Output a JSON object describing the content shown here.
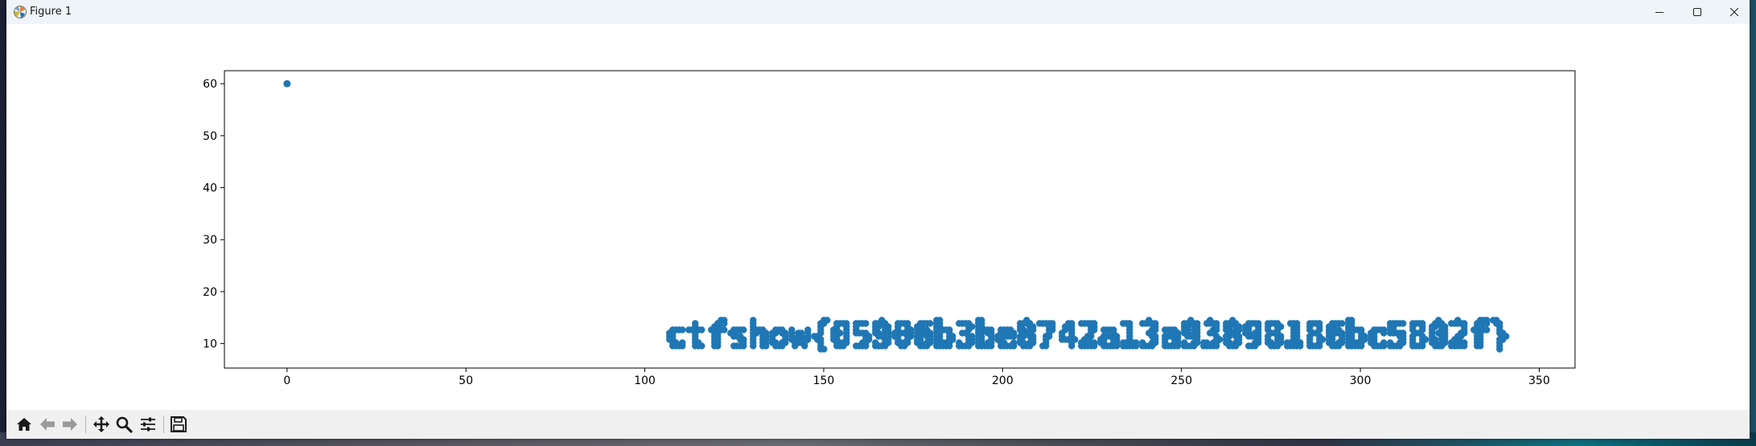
{
  "window": {
    "title": "Figure 1"
  },
  "toolbar": {
    "buttons": [
      {
        "name": "home-icon",
        "label": "Home"
      },
      {
        "name": "back-arrow-icon",
        "label": "Back"
      },
      {
        "name": "forward-arrow-icon",
        "label": "Forward"
      },
      {
        "name": "pan-icon",
        "label": "Pan"
      },
      {
        "name": "zoom-icon",
        "label": "Zoom"
      },
      {
        "name": "configure-subplots-icon",
        "label": "Subplots"
      },
      {
        "name": "save-icon",
        "label": "Save"
      }
    ]
  },
  "colors": {
    "marker": "#1f77b4",
    "titlebar": "#eff4f8",
    "toolbar": "#f0f0f0"
  },
  "chart_data": {
    "type": "scatter",
    "title": "",
    "xlabel": "",
    "ylabel": "",
    "xlim": [
      -17.5,
      360
    ],
    "ylim": [
      5.3,
      62.5
    ],
    "xticks": [
      0,
      50,
      100,
      150,
      200,
      250,
      300,
      350
    ],
    "yticks": [
      10,
      20,
      30,
      40,
      50,
      60
    ],
    "grid": false,
    "series": [
      {
        "points_note_free": true,
        "outlier": [
          [
            0,
            60
          ]
        ],
        "rendered_text": "ctfshow{05906b3be8742a13a93898186bc5802f}",
        "text_x_range": [
          106,
          342
        ],
        "text_y_range": [
          8.5,
          14.5
        ]
      }
    ]
  }
}
